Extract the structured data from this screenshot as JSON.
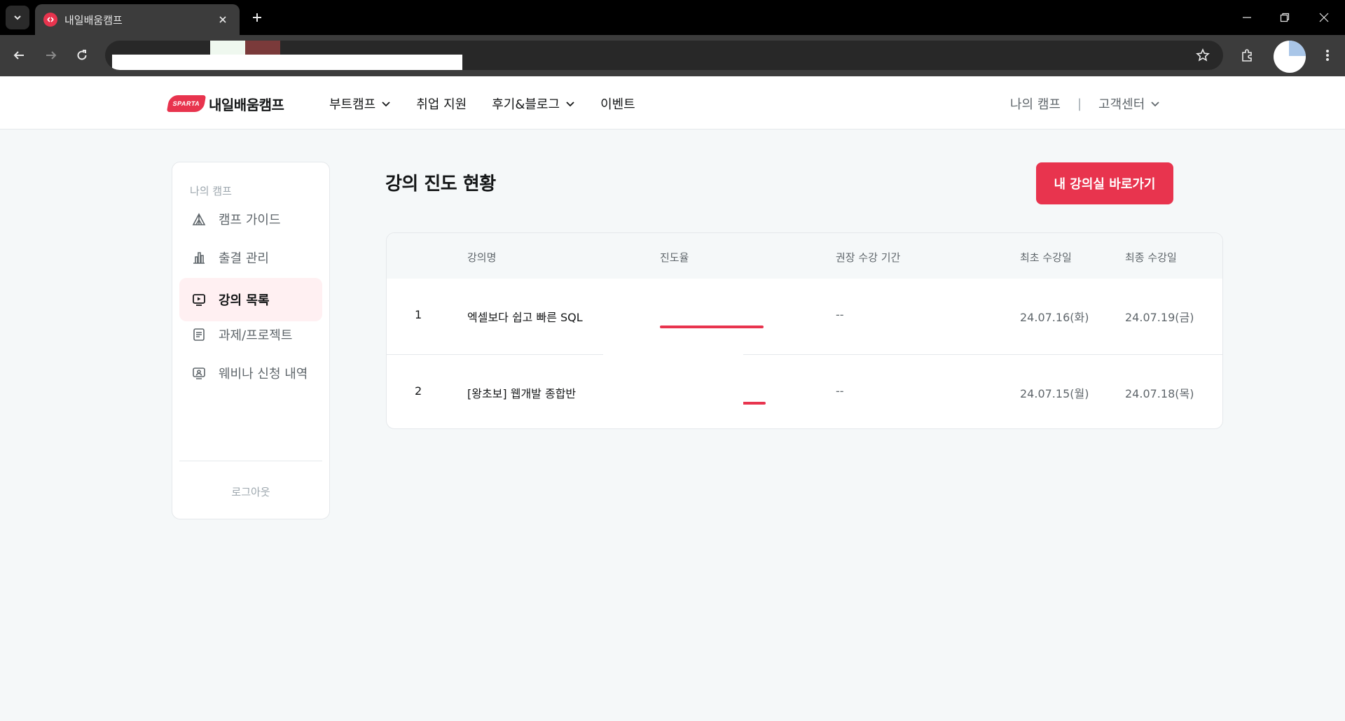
{
  "browser": {
    "tab_title": "내일배움캠프",
    "url": ""
  },
  "header": {
    "logo_badge": "SPARTA",
    "logo_text": "내일배움캠프",
    "nav": [
      {
        "label": "부트캠프",
        "has_dropdown": true
      },
      {
        "label": "취업 지원",
        "has_dropdown": false
      },
      {
        "label": "후기&블로그",
        "has_dropdown": true
      },
      {
        "label": "이벤트",
        "has_dropdown": false
      }
    ],
    "my_camp": "나의 캠프",
    "separator": "|",
    "support": "고객센터"
  },
  "sidebar": {
    "heading": "나의 캠프",
    "items": [
      {
        "label": "캠프 가이드",
        "icon": "tent-icon",
        "active": false
      },
      {
        "label": "출결 관리",
        "icon": "bar-chart-icon",
        "active": false
      },
      {
        "label": "강의 목록",
        "icon": "video-play-icon",
        "active": true
      },
      {
        "label": "과제/프로젝트",
        "icon": "document-icon",
        "active": false
      },
      {
        "label": "웨비나 신청 내역",
        "icon": "webinar-icon",
        "active": false
      }
    ],
    "logout": "로그아웃"
  },
  "main": {
    "title": "강의 진도 현황",
    "cta_label": "내 강의실 바로가기",
    "table": {
      "headers": {
        "name": "강의명",
        "progress": "진도율",
        "period": "권장 수강 기간",
        "first": "최초 수강일",
        "last": "최종 수강일"
      },
      "rows": [
        {
          "index": "1",
          "name": "엑셀보다 쉽고 빠른 SQL",
          "progress": 1.0,
          "period": "--",
          "first": "24.07.16(화)",
          "last": "24.07.19(금)"
        },
        {
          "index": "2",
          "name": "[왕초보] 웹개발 종합반",
          "progress": 1.0,
          "period": "--",
          "first": "24.07.15(월)",
          "last": "24.07.18(목)"
        }
      ]
    }
  },
  "colors": {
    "accent": "#e8344e",
    "active_bg": "#fff0f2",
    "page_bg": "#f5f8f9"
  }
}
